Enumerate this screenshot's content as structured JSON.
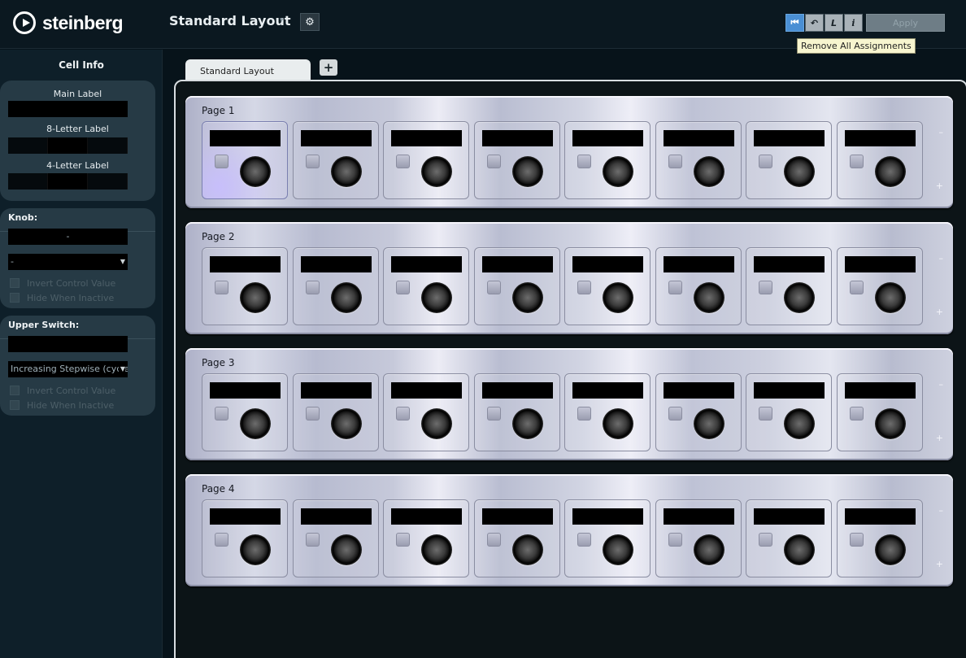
{
  "app": {
    "brand": "steinberg",
    "layout_title": "Standard Layout",
    "layout_caret": "▾",
    "settings_icon": "⚙"
  },
  "toolbar": {
    "buttons": [
      {
        "name": "remove-all-assignments-button",
        "glyph": "⏮",
        "active": true
      },
      {
        "name": "undo-button",
        "glyph": "↶"
      },
      {
        "name": "learn-button",
        "glyph": "L"
      },
      {
        "name": "info-button",
        "glyph": "i"
      }
    ],
    "apply_label": "Apply",
    "tooltip": "Remove All Assignments"
  },
  "sidebar": {
    "title": "Cell Info",
    "labels_panel": {
      "main_label": "Main Label",
      "eight_letter_label": "8-Letter Label",
      "four_letter_label": "4-Letter Label"
    },
    "knob_panel": {
      "heading": "Knob:",
      "value": "-",
      "mode": "-",
      "invert": "Invert Control Value",
      "hide": "Hide When Inactive"
    },
    "switch_panel": {
      "heading": "Upper Switch:",
      "value": "",
      "mode": "Increasing Stepwise (cycle",
      "invert": "Invert Control Value",
      "hide": "Hide When Inactive"
    }
  },
  "tabs": {
    "active": "Standard Layout",
    "add": "+"
  },
  "pages": [
    {
      "title": "Page 1",
      "minus": "–",
      "plus": "+",
      "selected_cell": 1
    },
    {
      "title": "Page 2",
      "minus": "–",
      "plus": "+"
    },
    {
      "title": "Page 3",
      "minus": "–",
      "plus": "+"
    },
    {
      "title": "Page 4",
      "minus": "–",
      "plus": "+"
    }
  ],
  "cells_per_page": 8,
  "colors": {
    "background": "#07131a",
    "panel": "#263a45",
    "accent_active": "#4a8fd4",
    "tooltip": "#f7f5cf"
  }
}
